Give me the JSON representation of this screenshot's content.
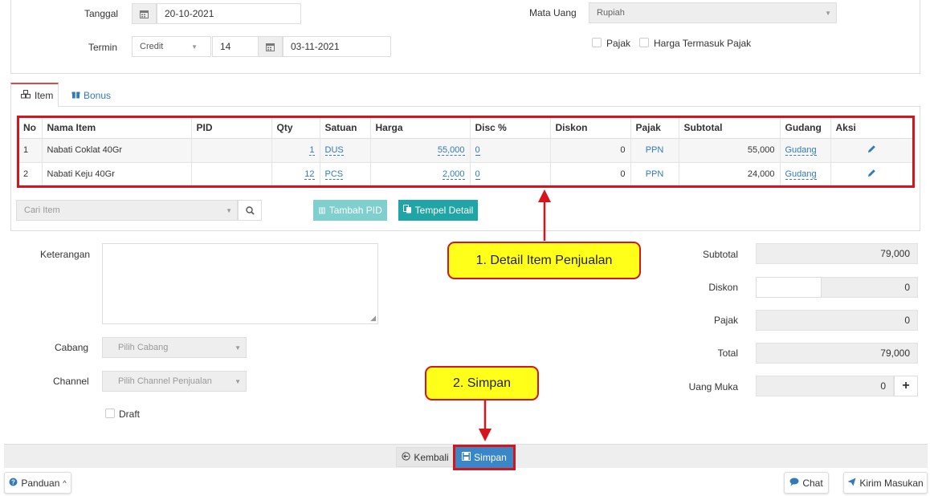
{
  "header": {
    "tanggal_label": "Tanggal",
    "tanggal_value": "20-10-2021",
    "termin_label": "Termin",
    "termin_type": "Credit",
    "termin_days": "14",
    "termin_date": "03-11-2021",
    "mata_uang_label": "Mata Uang",
    "mata_uang_value": "Rupiah",
    "pajak_label": "Pajak",
    "harga_termasuk_pajak_label": "Harga Termasuk Pajak"
  },
  "tabs": [
    {
      "label": "Item",
      "icon": "cubes-icon",
      "active": true
    },
    {
      "label": "Bonus",
      "icon": "gift-icon",
      "active": false
    }
  ],
  "table": {
    "columns": [
      "No",
      "Nama Item",
      "PID",
      "Qty",
      "Satuan",
      "Harga",
      "Disc %",
      "Diskon",
      "Pajak",
      "Subtotal",
      "Gudang",
      "Aksi"
    ],
    "rows": [
      {
        "no": "1",
        "nama": "Nabati Coklat 40Gr",
        "pid": "",
        "qty": "1",
        "satuan": "DUS",
        "harga": "55,000",
        "disc": "0",
        "diskon": "0",
        "pajak": "PPN",
        "subtotal": "55,000",
        "gudang": "Gudang"
      },
      {
        "no": "2",
        "nama": "Nabati Keju 40Gr",
        "pid": "",
        "qty": "12",
        "satuan": "PCS",
        "harga": "2,000",
        "disc": "0",
        "diskon": "0",
        "pajak": "PPN",
        "subtotal": "24,000",
        "gudang": "Gudang"
      }
    ]
  },
  "item_tools": {
    "search_placeholder": "Cari Item",
    "tambah_pid_label": "Tambah PID",
    "tempel_detail_label": "Tempel Detail"
  },
  "form": {
    "keterangan_label": "Keterangan",
    "cabang_label": "Cabang",
    "cabang_placeholder": "Pilih Cabang",
    "channel_label": "Channel",
    "channel_placeholder": "Pilih Channel Penjualan",
    "draft_label": "Draft"
  },
  "summary": {
    "subtotal_label": "Subtotal",
    "subtotal_value": "79,000",
    "diskon_label": "Diskon",
    "diskon_value": "0",
    "pajak_label": "Pajak",
    "pajak_value": "0",
    "total_label": "Total",
    "total_value": "79,000",
    "uang_muka_label": "Uang Muka",
    "uang_muka_value": "0"
  },
  "actions": {
    "kembali_label": "Kembali",
    "simpan_label": "Simpan"
  },
  "callouts": {
    "detail": "1. Detail Item Penjualan",
    "simpan": "2. Simpan"
  },
  "bottom": {
    "panduan_label": "Panduan",
    "chat_label": "Chat",
    "kirim_masukan_label": "Kirim Masukan"
  },
  "colors": {
    "accent_red": "#d6141c",
    "callout_yellow": "#ffff1a",
    "teal": "#1fa5a5",
    "link_blue": "#337ab7"
  }
}
